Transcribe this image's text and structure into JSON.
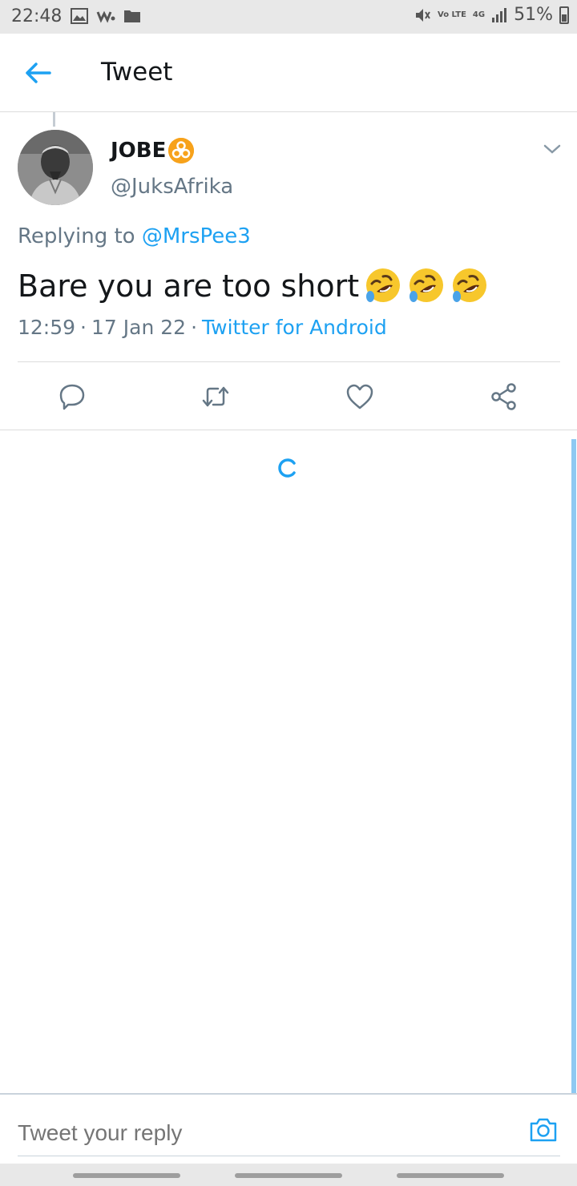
{
  "status_bar": {
    "time": "22:48",
    "battery_text": "51%",
    "volte_label": "Vo LTE",
    "network_label": "4G",
    "icons": [
      "image-icon",
      "music-icon",
      "folder-icon",
      "mute-icon",
      "volte-icon",
      "network-4g-icon",
      "signal-icon",
      "battery-icon"
    ]
  },
  "header": {
    "title": "Tweet",
    "back_icon": "back-arrow-icon"
  },
  "tweet": {
    "display_name": "JOBE",
    "name_emoji": "biohazard-icon",
    "username": "@JuksAfrika",
    "replying_prefix": "Replying to ",
    "replying_to": "@MrsPee3",
    "text": "Bare you are too short",
    "text_emojis": [
      "rolling-laughing-emoji",
      "rolling-laughing-emoji",
      "rolling-laughing-emoji"
    ],
    "time": "12:59",
    "date": "17 Jan 22",
    "source": "Twitter for Android"
  },
  "actions": {
    "icons": [
      "reply-icon",
      "retweet-icon",
      "like-icon",
      "share-icon"
    ]
  },
  "reply_bar": {
    "placeholder": "Tweet your reply",
    "camera_icon": "camera-icon"
  },
  "colors": {
    "accent": "#1da1f2",
    "secondary_text": "#657786",
    "primary_text": "#14171a",
    "emoji_yellow": "#f7c72c",
    "biohazard_orange": "#f7a21b"
  }
}
